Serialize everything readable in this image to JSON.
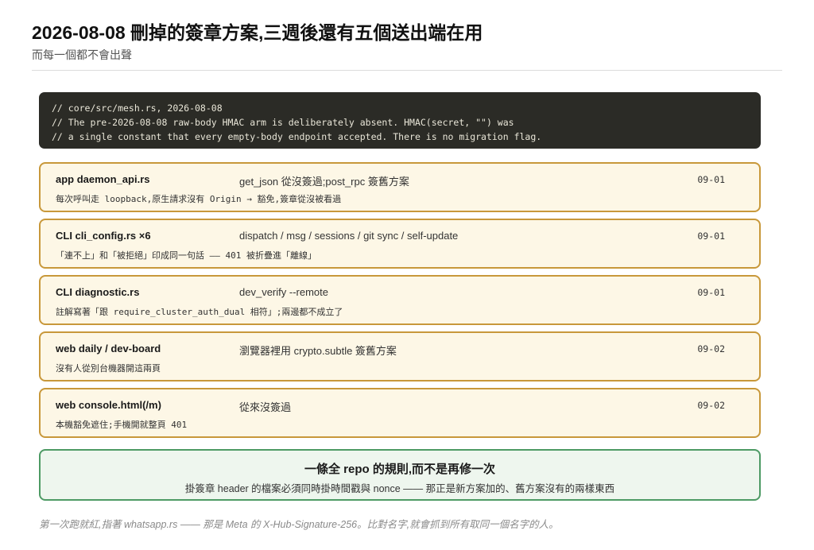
{
  "header": {
    "title": "2026-08-08 刪掉的簽章方案,三週後還有五個送出端在用",
    "subtitle": "而每一個都不會出聲"
  },
  "code": {
    "lines": [
      "// core/src/mesh.rs, 2026-08-08",
      "// The pre-2026-08-08 raw-body HMAC arm is deliberately absent. HMAC(secret, \"\") was",
      "// a single constant that every empty-body endpoint accepted. There is no migration flag."
    ]
  },
  "cards": [
    {
      "name": "app daemon_api.rs",
      "what": "get_json 從沒簽過;post_rpc 簽舊方案",
      "date": "09-01",
      "note": "每次呼叫走 loopback,原生請求沒有 Origin → 豁免,簽章從沒被看過"
    },
    {
      "name": "CLI cli_config.rs ×6",
      "what": "dispatch / msg / sessions / git sync / self-update",
      "date": "09-01",
      "note": "「連不上」和「被拒絕」印成同一句話 —— 401 被折疊進「離線」"
    },
    {
      "name": "CLI diagnostic.rs",
      "what": "dev_verify --remote",
      "date": "09-01",
      "note": "註解寫著「跟 require_cluster_auth_dual 相符」;兩邊都不成立了"
    },
    {
      "name": "web daily / dev-board",
      "what": "瀏覽器裡用 crypto.subtle 簽舊方案",
      "date": "09-02",
      "note": "沒有人從別台機器開這兩頁"
    },
    {
      "name": "web console.html(/m)",
      "what": "從來沒簽過",
      "date": "09-02",
      "note": "本機豁免遮住;手機開就整頁 401"
    }
  ],
  "rule_box": {
    "head": "一條全 repo 的規則,而不是再修一次",
    "body": "掛簽章 header 的檔案必須同時掛時間戳與 nonce —— 那正是新方案加的、舊方案沒有的兩樣東西"
  },
  "footer": "第一次跑就紅,指著 whatsapp.rs —— 那是 Meta 的 X-Hub-Signature-256。比對名字,就會抓到所有取同一個名字的人。"
}
